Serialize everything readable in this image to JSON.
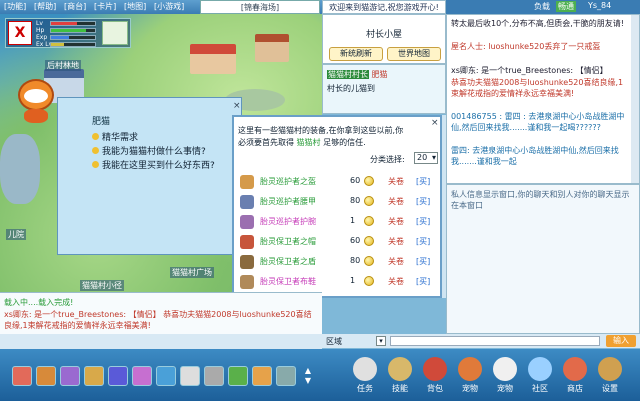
{
  "menu": [
    "[功能]",
    "[帮助]",
    "[商台]",
    "[卡片]",
    "[地图]",
    "[小游戏]"
  ],
  "scene_title": "[锦春海场]",
  "announcement": "欢迎来到猫游记,祝您游戏开心!",
  "top_right": {
    "tab_left": "负载",
    "tab_right": "畅通",
    "code": "Ys_84"
  },
  "status": {
    "labels": [
      "Lv",
      "Hp",
      "Exp",
      "Ex Lv"
    ]
  },
  "map_labels": [
    "后村林地",
    "儿院",
    "猫猫村广场",
    "猫猫村小径"
  ],
  "npc_panel": {
    "title": "村长小屋",
    "buttons": [
      "新统刷新",
      "世界地图"
    ],
    "npc_tag": "猫猫村村长",
    "npc_name_suffix": "肥猫",
    "npc_desc": "村长的儿猫到"
  },
  "dialog": {
    "npc_name": "肥猫",
    "options": [
      "精华需求",
      "我能为猫猫村做什么事情?",
      "我能在这里买到什么好东西?"
    ],
    "close": "×"
  },
  "shop": {
    "intro_1": "这里有一些猫猫村的装备,在你拿到这些以前,你",
    "intro_2": "必须要首先取得",
    "intro_link": "猫猫村",
    "intro_3": "足够的信任.",
    "category_label": "分类选择:",
    "category_value": "20",
    "close": "×",
    "items": [
      {
        "name": "胎灵巡护者之盔",
        "price": "60",
        "action": "关卷",
        "buy": "[买]",
        "color": "#2a9c3a",
        "icon": "#d59a4a"
      },
      {
        "name": "胎灵巡护者腰甲",
        "price": "80",
        "action": "关卷",
        "buy": "[买]",
        "color": "#2a9c3a",
        "icon": "#6a7fb0"
      },
      {
        "name": "胎灵巡护者护腕",
        "price": "1",
        "action": "关卷",
        "buy": "[买]",
        "color": "#c63cb8",
        "icon": "#9b6fb0"
      },
      {
        "name": "胎灵保卫者之帽",
        "price": "60",
        "action": "关卷",
        "buy": "[买]",
        "color": "#2a9c3a",
        "icon": "#c7553b"
      },
      {
        "name": "胎灵保卫者之盾",
        "price": "80",
        "action": "关卷",
        "buy": "[买]",
        "color": "#2a9c3a",
        "icon": "#8a6a3e"
      },
      {
        "name": "胎灵保卫者布鞋",
        "price": "1",
        "action": "关卷",
        "buy": "[买]",
        "color": "#c63cb8",
        "icon": "#b08a5a"
      }
    ]
  },
  "chat_right": [
    {
      "text": "转太最后收10个,分布不高,但质会,干脆的朋友请!",
      "color": "#223"
    },
    {
      "text": "屋名人士: luoshunke520丢弃了一只戒盔",
      "color": "#c0392b"
    },
    {
      "text": "xs卿东: 是一个true_Breestones: 【情侣】",
      "color": "#223"
    },
    {
      "text": "恭喜功夫猫猫2008与luoshunke520喜结良缘,1束解花戒指的爱情祥永远幸福美满!",
      "color": "#c0392b"
    },
    {
      "text": "001486755 : 雷四 : 去港泉湖中心小岛战胜湖中仙,然后回来找我.......谨和我一起喝??????",
      "color": "#1b6fa8"
    },
    {
      "text": "雷四: 去港泉湖中心小岛战胜湖中仙,然后回来找我.......谨和我一起",
      "color": "#1b6fa8"
    }
  ],
  "private_hint": "私人信息显示窗口,你的聊天和别人对你的聊天显示在本窗口",
  "chat_bottom": {
    "system": "载入中....载入完成!",
    "line": "xs卿东: 是一个true_Breestones: 【情侣】 恭喜功夫猫猫2008与luoshunke520喜结良缘,1束解花戒指的爱情祥永远幸福美满!"
  },
  "input": {
    "channel": "区域",
    "send": "输入"
  },
  "toolbar": {
    "slot_colors": [
      "#e26a5a",
      "#d78a3a",
      "#9a6ad0",
      "#d8a94a",
      "#5a5ad8",
      "#c66fd0",
      "#4aa0d8",
      "#ddd",
      "#aaa",
      "#5ab04a",
      "#e6a24a",
      "#8aa"
    ],
    "buttons": [
      {
        "label": "任务",
        "color": "#e0e0e0"
      },
      {
        "label": "技能",
        "color": "#d8b86a"
      },
      {
        "label": "背包",
        "color": "#d04a3a"
      },
      {
        "label": "宠物",
        "color": "#e07a3a"
      },
      {
        "label": "宠物",
        "color": "#f0f0f0"
      },
      {
        "label": "社区",
        "color": "#9ad0ff"
      },
      {
        "label": "商店",
        "color": "#e26a4a"
      },
      {
        "label": "设置",
        "color": "#d0a050"
      }
    ]
  }
}
